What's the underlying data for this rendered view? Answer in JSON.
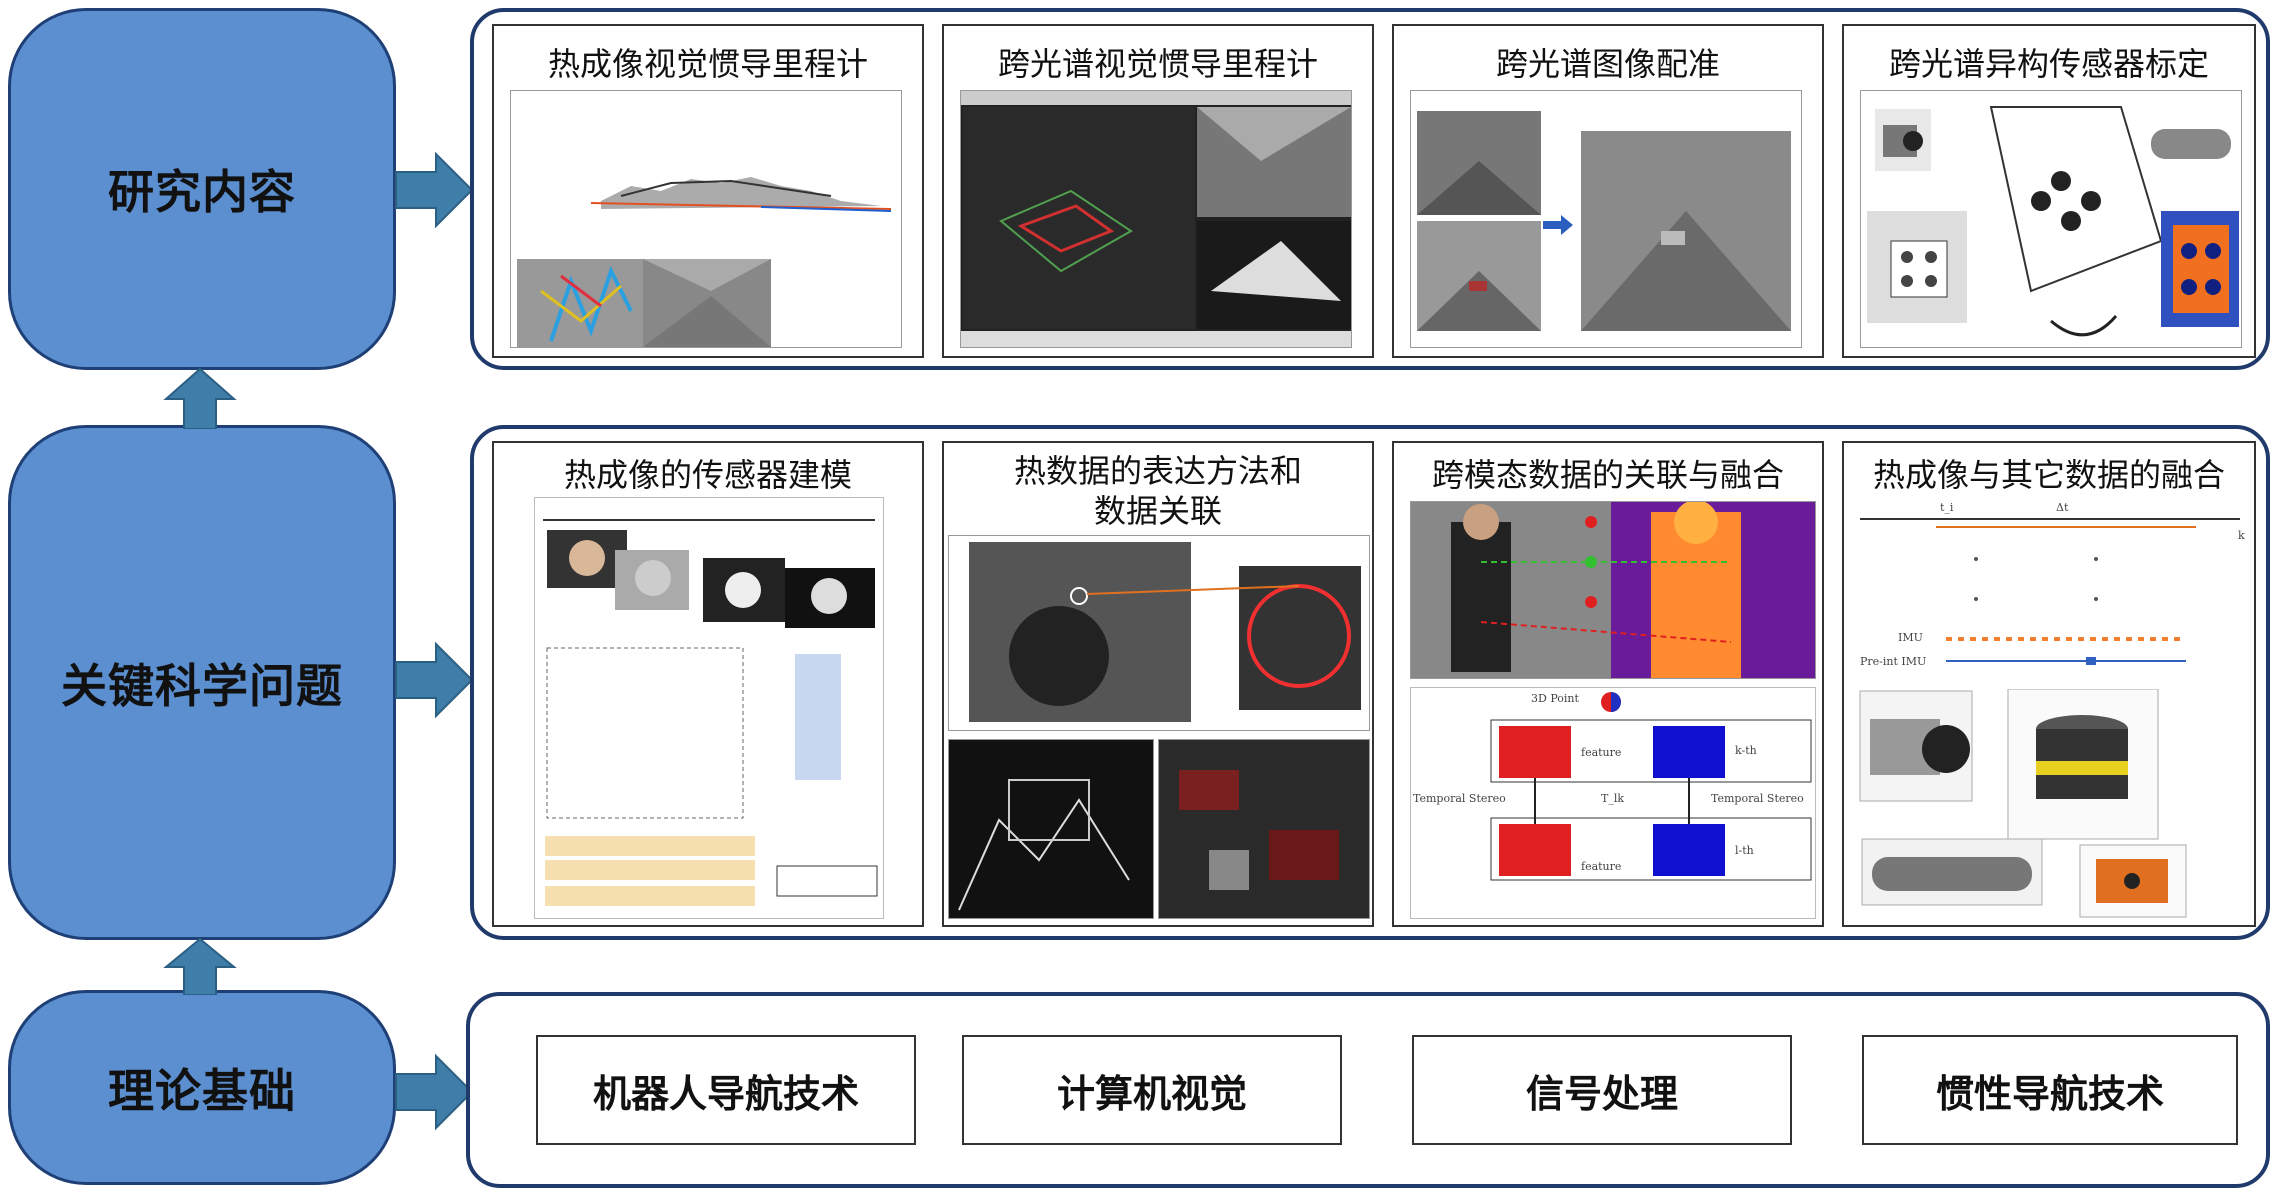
{
  "levels": {
    "research": {
      "label": "研究内容",
      "items": [
        "热成像视觉惯导里程计",
        "跨光谱视觉惯导里程计",
        "跨光谱图像配准",
        "跨光谱异构传感器标定"
      ]
    },
    "key": {
      "label": "关键科学问题",
      "items": [
        {
          "line1": "热成像的传感器建模",
          "line2": ""
        },
        {
          "line1": "热数据的表达方法和",
          "line2": "数据关联"
        },
        {
          "line1": "跨模态数据的关联与融合",
          "line2": ""
        },
        {
          "line1": "热成像与其它数据的融合",
          "line2": ""
        }
      ]
    },
    "theory": {
      "label": "理论基础",
      "items": [
        "机器人导航技术",
        "计算机视觉",
        "信号处理",
        "惯性导航技术"
      ]
    }
  },
  "figure_text": {
    "point3d": "3D Point",
    "kth": "k-th",
    "lth": "l-th",
    "temporal_stereo": "Temporal Stereo",
    "tlk": "T_lk",
    "feature": "feature",
    "imu": "IMU",
    "preint_imu": "Pre-int IMU",
    "ti": "t_i",
    "dt": "Δt",
    "k_mark": "k"
  },
  "colors": {
    "left_fill": "#5b8fd0",
    "left_border": "#1f3f77",
    "arrow": "#3f7ea8",
    "panel_border": "#1f3a6b"
  }
}
